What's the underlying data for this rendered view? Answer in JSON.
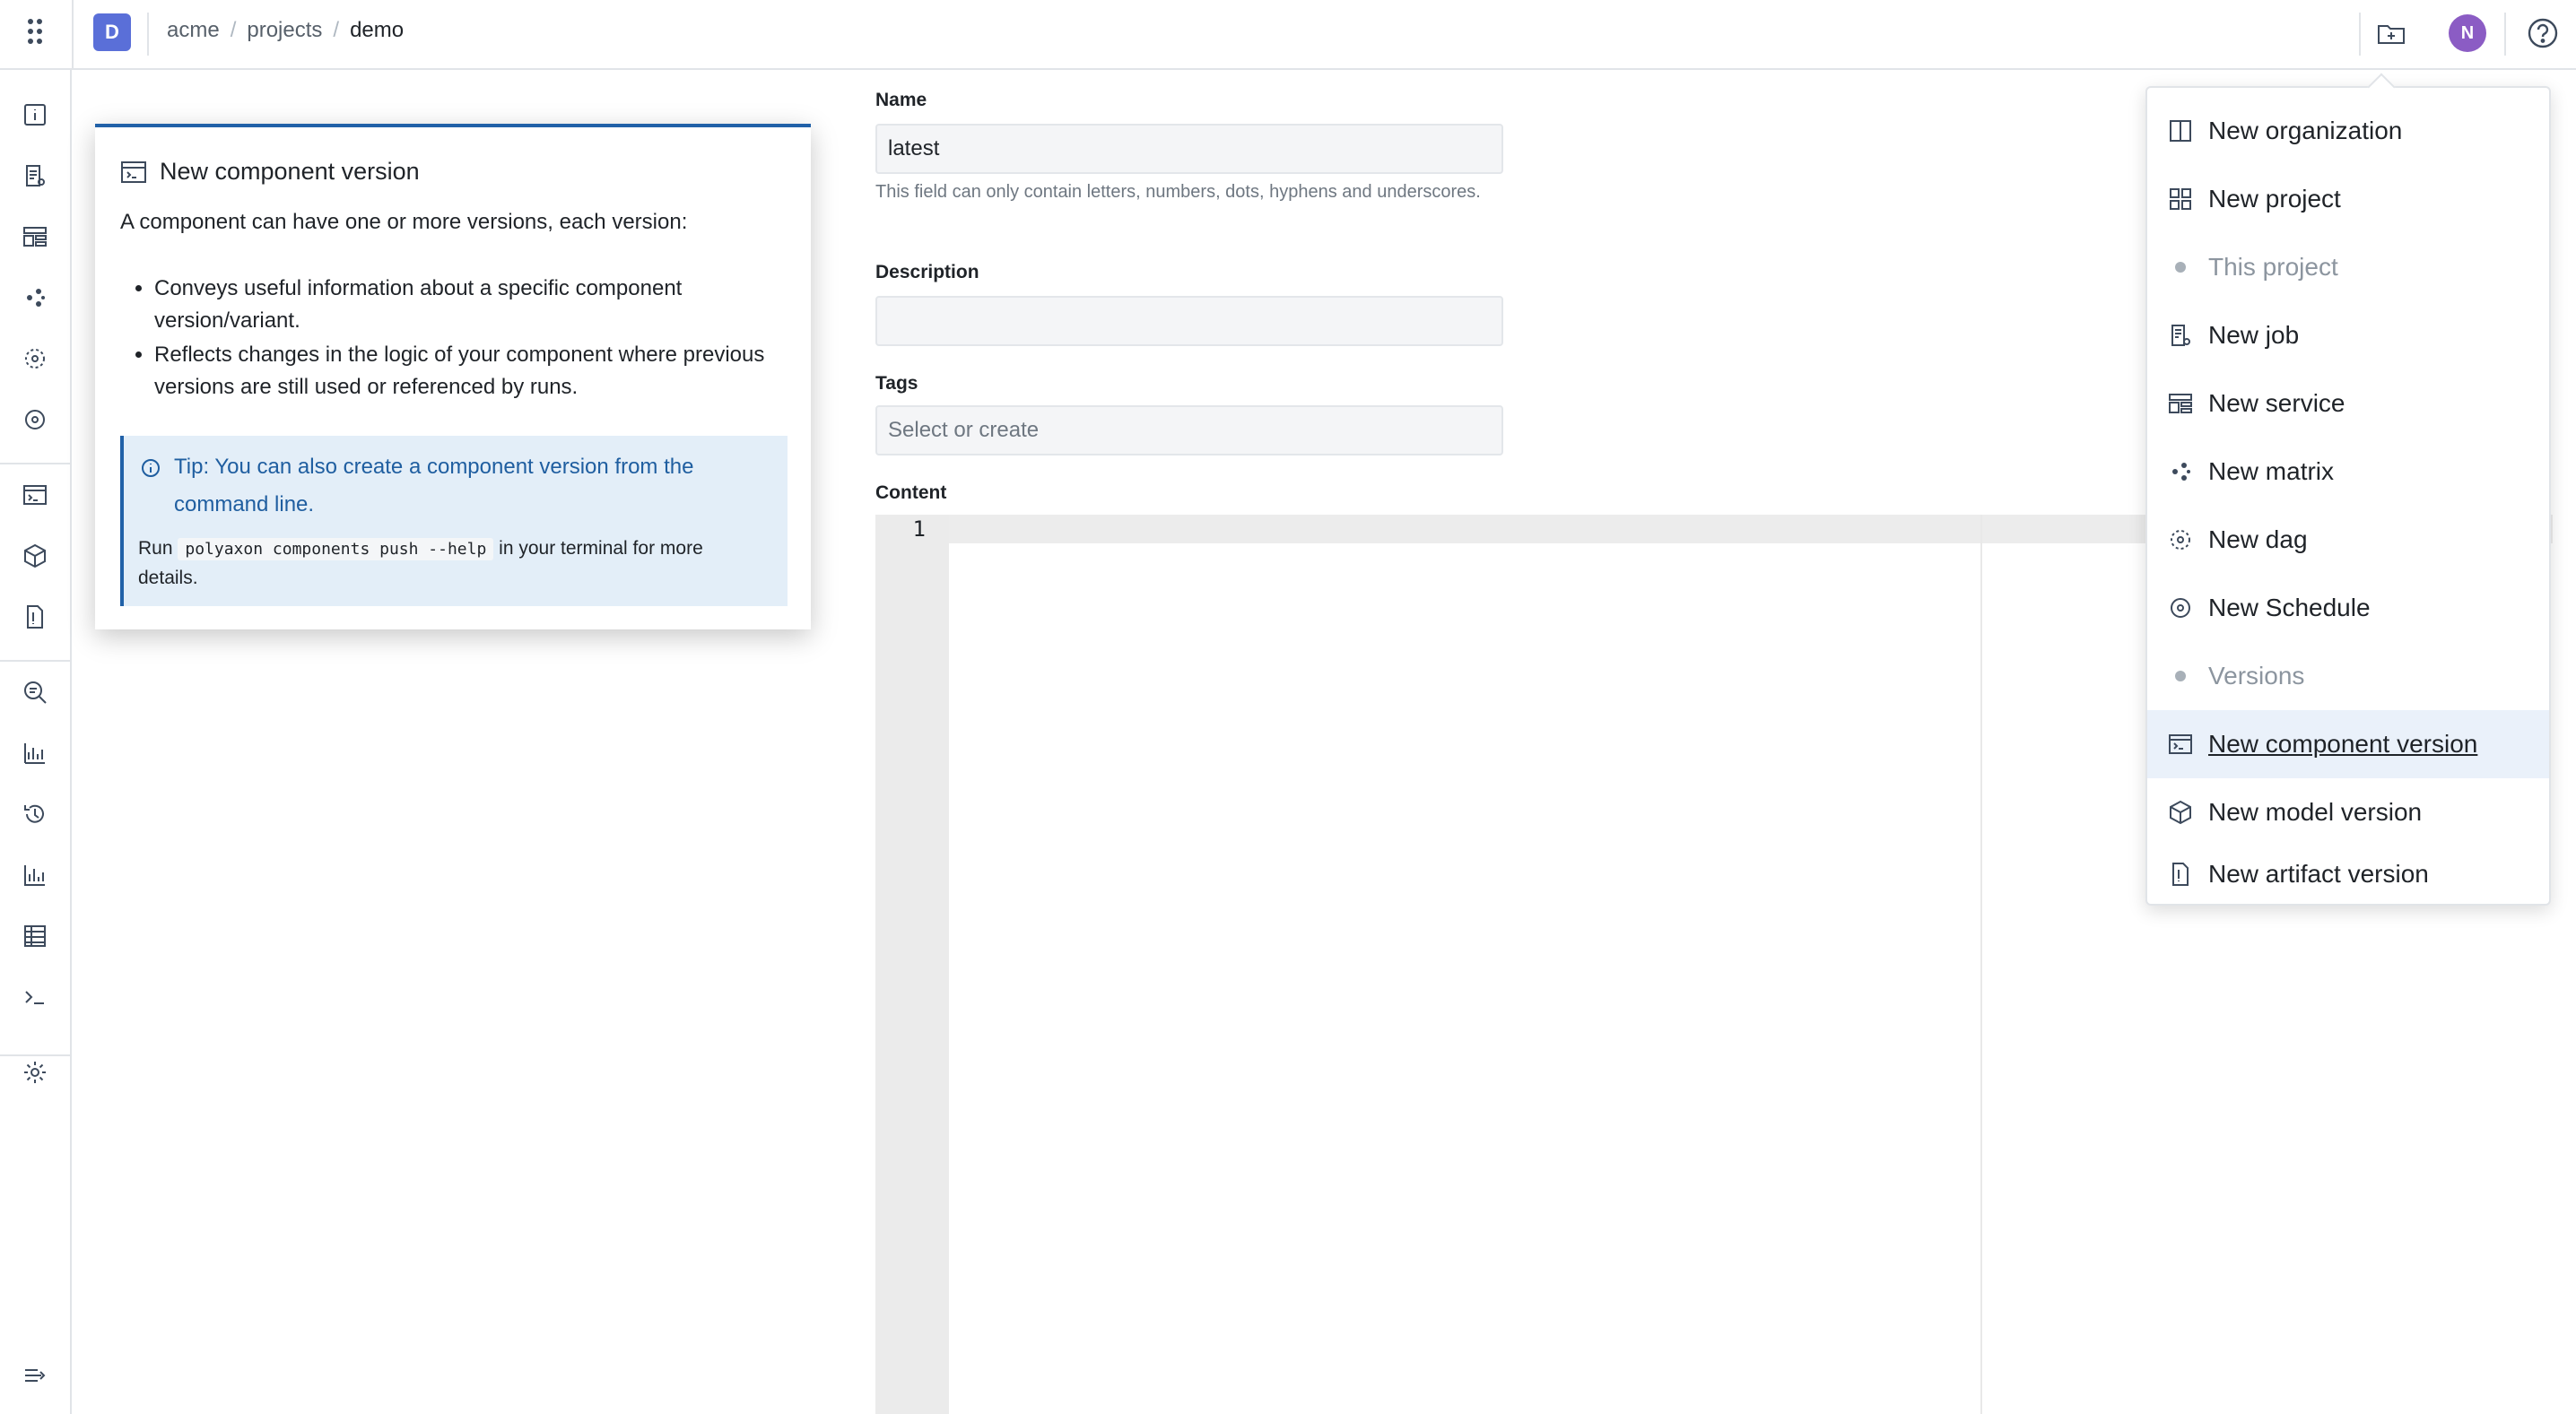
{
  "topbar": {
    "org_initial": "D",
    "breadcrumb": {
      "org": "acme",
      "sep1": "/",
      "section": "projects",
      "sep2": "/",
      "project": "demo"
    },
    "user_initial": "N"
  },
  "help_panel": {
    "title": "New component version",
    "intro": "A component can have one or more versions, each version:",
    "bullets": [
      "Conveys useful information about a specific component version/variant.",
      "Reflects changes in the logic of your component where previous versions are still used or referenced by runs."
    ],
    "tip": {
      "text": "Tip: You can also create a component version from the command line.",
      "run_prefix": "Run",
      "command": "polyaxon components push --help",
      "run_suffix": "in your terminal for more details."
    }
  },
  "form": {
    "name_label": "Name",
    "name_value": "latest",
    "name_help": "This field can only contain letters, numbers, dots, hyphens and underscores.",
    "description_label": "Description",
    "description_value": "",
    "tags_label": "Tags",
    "tags_placeholder": "Select or create",
    "content_label": "Content",
    "line_number": "1"
  },
  "create_menu": {
    "items": [
      {
        "label": "New organization",
        "icon": "organization-icon",
        "type": "item"
      },
      {
        "label": "New project",
        "icon": "project-icon",
        "type": "item"
      },
      {
        "label": "This project",
        "icon": "dot",
        "type": "header"
      },
      {
        "label": "New job",
        "icon": "job-icon",
        "type": "item"
      },
      {
        "label": "New service",
        "icon": "service-icon",
        "type": "item"
      },
      {
        "label": "New matrix",
        "icon": "matrix-icon",
        "type": "item"
      },
      {
        "label": "New dag",
        "icon": "dag-icon",
        "type": "item"
      },
      {
        "label": "New Schedule",
        "icon": "schedule-icon",
        "type": "item"
      },
      {
        "label": "Versions",
        "icon": "dot",
        "type": "header"
      },
      {
        "label": "New component version",
        "icon": "component-icon",
        "type": "item",
        "active": true
      },
      {
        "label": "New model version",
        "icon": "model-icon",
        "type": "item"
      },
      {
        "label": "New artifact version",
        "icon": "artifact-icon",
        "type": "item"
      }
    ]
  },
  "colors": {
    "accent": "#2161a8",
    "org_badge": "#5a6fd8",
    "avatar": "#8b5cc4",
    "tip_bg": "#e3eef8"
  }
}
